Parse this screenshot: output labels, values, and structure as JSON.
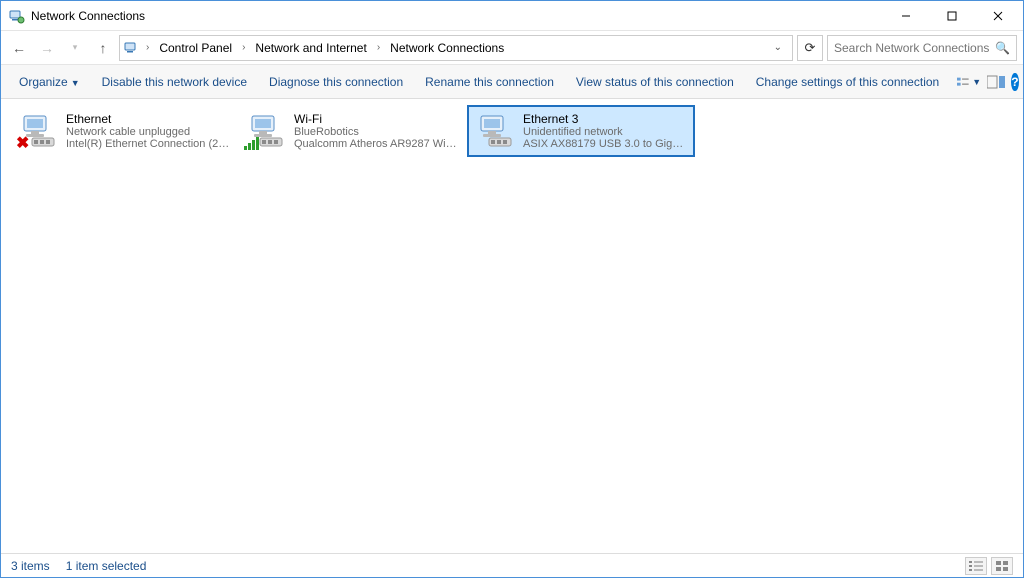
{
  "window": {
    "title": "Network Connections"
  },
  "breadcrumb": {
    "items": [
      "Control Panel",
      "Network and Internet",
      "Network Connections"
    ]
  },
  "search": {
    "placeholder": "Search Network Connections"
  },
  "commands": {
    "organize": "Organize",
    "disable": "Disable this network device",
    "diagnose": "Diagnose this connection",
    "rename": "Rename this connection",
    "view_status": "View status of this connection",
    "change_settings": "Change settings of this connection"
  },
  "connections": [
    {
      "name": "Ethernet",
      "status": "Network cable unplugged",
      "device": "Intel(R) Ethernet Connection (2) I...",
      "icon": "ethernet",
      "overlay": "x",
      "selected": false
    },
    {
      "name": "Wi-Fi",
      "status": "BlueRobotics",
      "device": "Qualcomm Atheros AR9287 Wirel...",
      "icon": "wifi",
      "overlay": "bars",
      "selected": false
    },
    {
      "name": "Ethernet 3",
      "status": "Unidentified network",
      "device": "ASIX AX88179 USB 3.0 to Gigabit E...",
      "icon": "ethernet",
      "overlay": "none",
      "selected": true
    }
  ],
  "statusbar": {
    "item_count": "3 items",
    "selected_count": "1 item selected"
  }
}
